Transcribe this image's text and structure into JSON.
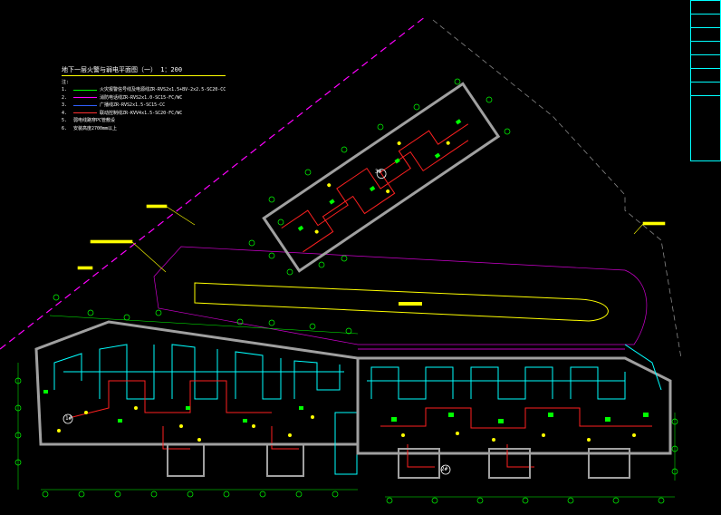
{
  "drawing": {
    "title": "地下一层火警与弱电平面图（一） 1：200",
    "legend": [
      {
        "key": "注:",
        "text": "",
        "color": ""
      },
      {
        "key": "1.",
        "text": "火灾报警信号线及电源线ZR-RVS2x1.5+BV-2x2.5-SC20-CC",
        "color": "#00ff00"
      },
      {
        "key": "2.",
        "text": "消防电话线ZR-RVS2x1.0-SC15-FC/WC",
        "color": "#ff00ff"
      },
      {
        "key": "3.",
        "text": "广播线ZR-RVS2x1.5-SC15-CC",
        "color": "#3060ff"
      },
      {
        "key": "4.",
        "text": "联动控制线ZR-KVV4x1.5-SC20-FC/WC",
        "color": "#ff3030"
      },
      {
        "key": "5.",
        "text": "弱电线路穿PC管敷设",
        "color": ""
      },
      {
        "key": "6.",
        "text": "安装高度2700mm以上",
        "color": ""
      }
    ],
    "zones": [
      "1#",
      "2#",
      "3#"
    ],
    "colors": {
      "background": "#000000",
      "walls": "#a0a0a0",
      "cyan_conduit": "#00ffff",
      "red_conduit": "#ff2020",
      "alarm_green": "#00ff00",
      "boundary_magenta": "#ff00ff",
      "leader_yellow": "#ffff00"
    }
  }
}
